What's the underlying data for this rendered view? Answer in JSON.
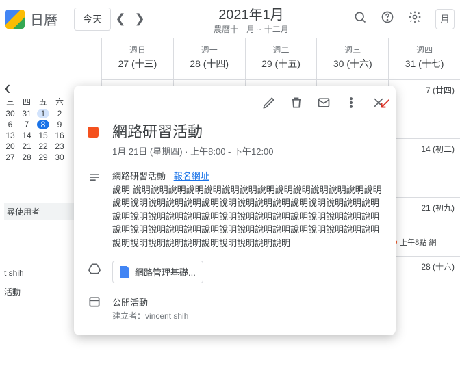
{
  "header": {
    "app_title": "日曆",
    "today_label": "今天",
    "month_title": "2021年1月",
    "month_sub": "農曆十一月 ~ 十二月"
  },
  "day_headers": [
    {
      "dow": "週日",
      "dnum": "27 (十三)"
    },
    {
      "dow": "週一",
      "dnum": "28 (十四)"
    },
    {
      "dow": "週二",
      "dnum": "29 (十五)"
    },
    {
      "dow": "週三",
      "dnum": "30 (十六)"
    },
    {
      "dow": "週四",
      "dnum": "31 (十七)"
    }
  ],
  "mini": {
    "hdr": [
      "三",
      "四",
      "五",
      "六"
    ],
    "r1": [
      "30",
      "31",
      "1",
      "2"
    ],
    "r2": [
      "6",
      "7",
      "8",
      "9"
    ],
    "r3": [
      "13",
      "14",
      "15",
      "16"
    ],
    "r4": [
      "20",
      "21",
      "22",
      "23"
    ],
    "r5": [
      "27",
      "28",
      "29",
      "30"
    ]
  },
  "left": {
    "guest_label": "尋使用者",
    "user_line": "t shih",
    "act_line": "活動"
  },
  "grid": {
    "r1c5": "7 (廿四)",
    "r2c5": "14 (初二)",
    "r3c5": "21 (初九)",
    "r3chip": "上午8點 網",
    "r4c5": "28 (十六)"
  },
  "event": {
    "title": "網路研習活動",
    "subtitle": "1月 21日 (星期四) · 上午8:00 - 下午12:00",
    "desc_title": "網路研習活動",
    "signup_link": "報名網址",
    "desc_body": "說明 說明說明說明說明說明說明說明說明說明說明說明說明說明說明說明說明說明說明說明說明說明說明說明說明說明說明說明說明說明說明說明說明說明說明說明說明說明說明說明說明說明說明說明說明說明說明說明說明說明說明說明說明說明說明說明說明說明說明說明說明說明說明說明說明說明說明說明說明說明",
    "attachment": "網路管理基礎...",
    "visibility": "公開活動",
    "owner_label": "建立者：",
    "owner_name": "vincent shih"
  }
}
